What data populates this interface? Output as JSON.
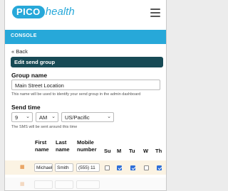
{
  "brand": {
    "pill": "PICO",
    "word": "health",
    "accent": "#27a8d9"
  },
  "console": {
    "label": "CONSOLE"
  },
  "nav": {
    "back_label": "« Back"
  },
  "page": {
    "title": "Edit send group"
  },
  "group_name": {
    "label": "Group name",
    "value": "Main Street Location",
    "help": "This name will be used to identify your send group in the admin dashboard"
  },
  "send_time": {
    "label": "Send time",
    "hour": "9",
    "ampm": "AM",
    "timezone": "US/Pacific",
    "help": "The SMS will be sent around this time"
  },
  "table": {
    "headers": {
      "first_name": "First name",
      "last_name": "Last name",
      "mobile": "Mobile number",
      "su": "Su",
      "m": "M",
      "tu": "Tu",
      "w": "W",
      "th": "Th"
    },
    "rows": [
      {
        "first_name": "Michael",
        "last_name": "Smith",
        "mobile": "(555) 11",
        "days": {
          "su": false,
          "m": true,
          "tu": true,
          "w": false,
          "th": true
        }
      }
    ]
  },
  "icons": {
    "menu": "hamburger-icon",
    "drag": "drag-handle-icon",
    "chevron": "chevron-down-icon"
  }
}
